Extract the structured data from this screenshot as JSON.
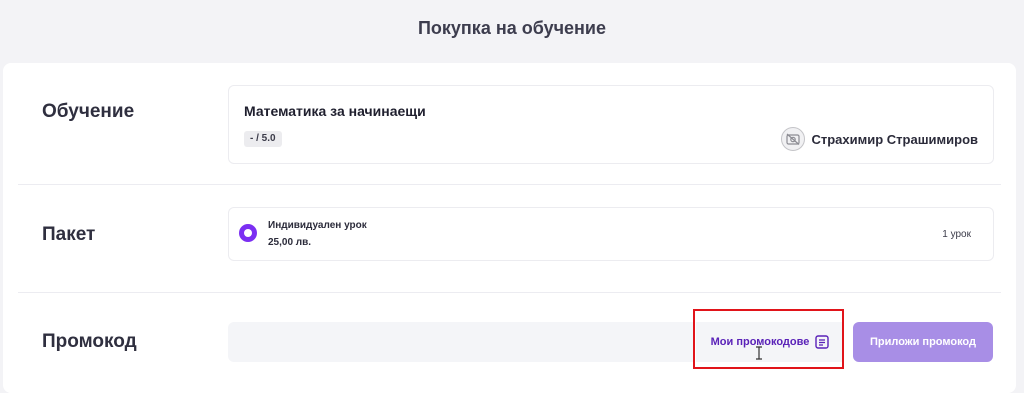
{
  "header": {
    "title": "Покупка на обучение"
  },
  "rows": {
    "training": {
      "label": "Обучение",
      "course_title": "Математика за начинаещи",
      "rating": "- / 5.0",
      "teacher_name": "Страхимир Страшимиров",
      "avatar_icon": "avatar-placeholder-icon"
    },
    "package": {
      "label": "Пакет",
      "name": "Индивидуален урок",
      "price": "25,00 лв.",
      "lessons": "1 урок",
      "selected": true
    },
    "promo": {
      "label": "Промокод",
      "input_value": "",
      "my_promos_label": "Мои промокодове",
      "my_promos_icon": "list-icon",
      "apply_label": "Приложи промокод"
    }
  },
  "colors": {
    "accent": "#7b2ff2",
    "apply_button": "#a88ee6",
    "link": "#5a22b8",
    "highlight": "#e1141a"
  }
}
